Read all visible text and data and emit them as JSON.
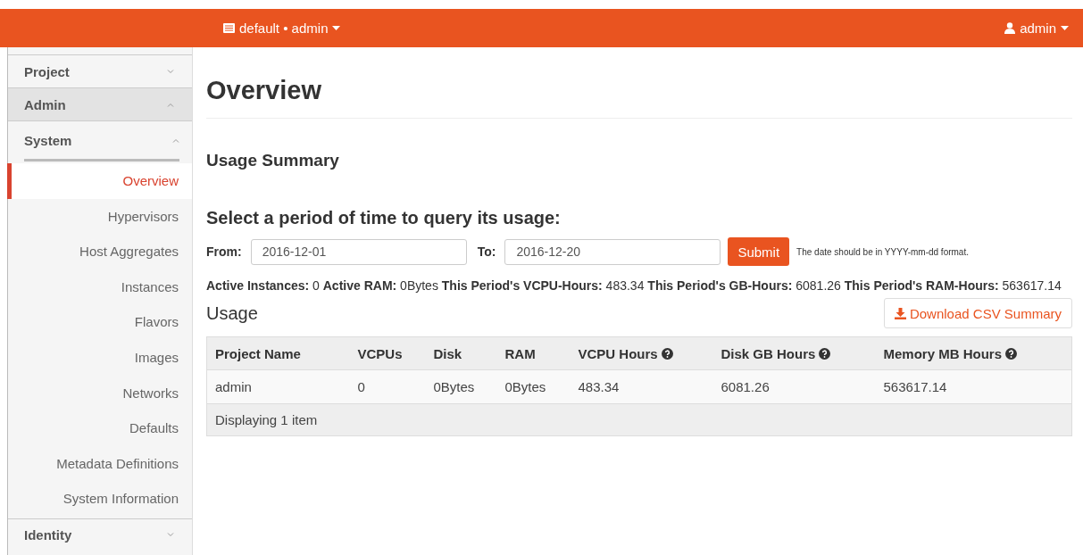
{
  "topbar": {
    "project_menu": "default • admin",
    "user_menu": "admin"
  },
  "sidebar": {
    "sections": [
      {
        "label": "Project",
        "expanded": false
      },
      {
        "label": "Admin",
        "expanded": true,
        "children": [
          {
            "label": "System",
            "expanded": true,
            "children": [
              {
                "label": "Overview",
                "selected": true
              },
              {
                "label": "Hypervisors",
                "selected": false
              },
              {
                "label": "Host Aggregates",
                "selected": false
              },
              {
                "label": "Instances",
                "selected": false
              },
              {
                "label": "Flavors",
                "selected": false
              },
              {
                "label": "Images",
                "selected": false
              },
              {
                "label": "Networks",
                "selected": false
              },
              {
                "label": "Defaults",
                "selected": false
              },
              {
                "label": "Metadata Definitions",
                "selected": false
              },
              {
                "label": "System Information",
                "selected": false
              }
            ]
          }
        ]
      },
      {
        "label": "Identity",
        "expanded": false
      }
    ]
  },
  "page": {
    "title": "Overview",
    "summary_heading": "Usage Summary",
    "period_heading": "Select a period of time to query its usage:",
    "form": {
      "from_label": "From:",
      "from_value": "2016-12-01",
      "to_label": "To:",
      "to_value": "2016-12-20",
      "submit": "Submit",
      "hint": "The date should be in YYYY-mm-dd format."
    },
    "stats": "**Active Instances:** 0 **Active RAM:** 0Bytes **This Period's VCPU-Hours:** 483.34 **This Period's GB-Hours:** 6081.26 **This Period's RAM-Hours:** 563617.14",
    "usage_heading": "Usage",
    "download_button": "Download CSV Summary",
    "table": {
      "columns": [
        {
          "label": "Project Name",
          "help": false
        },
        {
          "label": "VCPUs",
          "help": false
        },
        {
          "label": "Disk",
          "help": false
        },
        {
          "label": "RAM",
          "help": false
        },
        {
          "label": "VCPU Hours",
          "help": true
        },
        {
          "label": "Disk GB Hours",
          "help": true
        },
        {
          "label": "Memory MB Hours",
          "help": true
        }
      ],
      "rows": [
        [
          "admin",
          "0",
          "0Bytes",
          "0Bytes",
          "483.34",
          "6081.26",
          "563617.14"
        ]
      ],
      "footer": "Displaying 1 item"
    }
  }
}
